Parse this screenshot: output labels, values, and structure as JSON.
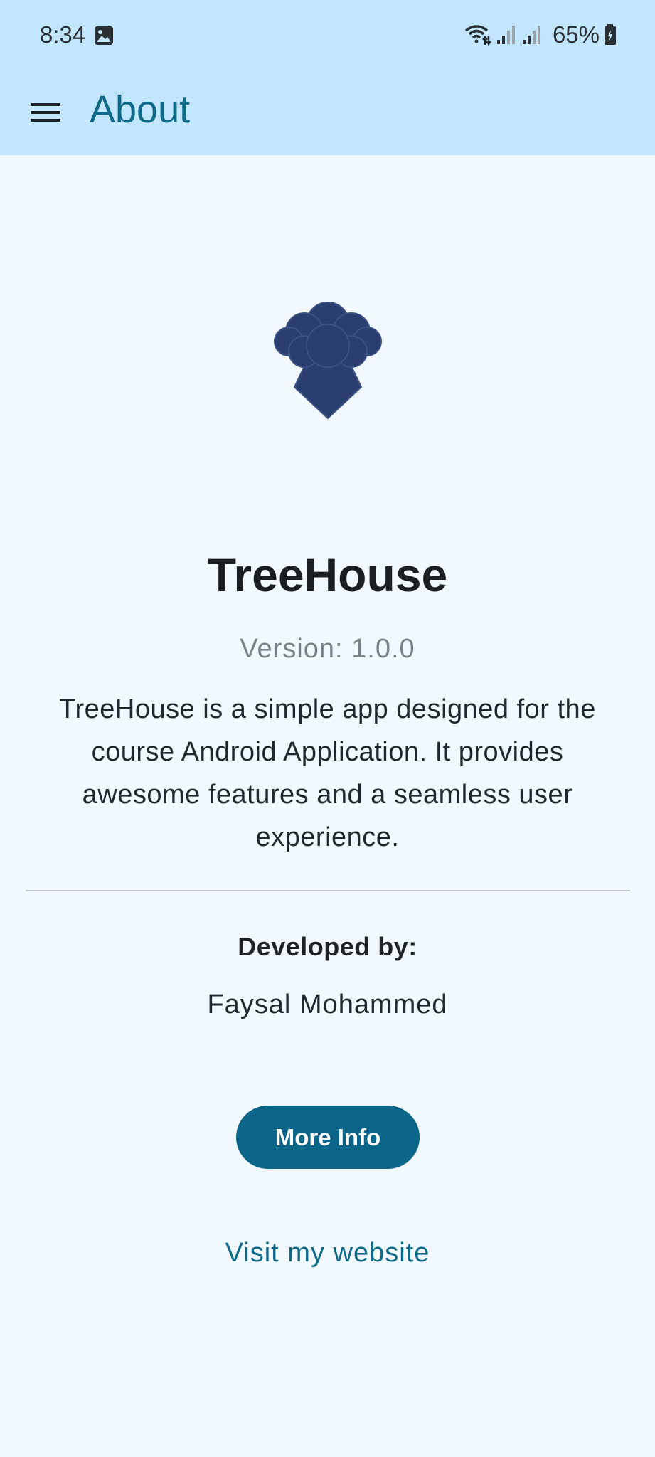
{
  "status_bar": {
    "time": "8:34",
    "battery": "65%",
    "icons": [
      "gallery-icon",
      "wifi-icon",
      "signal-icon",
      "signal-icon",
      "battery-icon"
    ]
  },
  "app_bar": {
    "title": "About",
    "menu_icon": "hamburger-menu-icon"
  },
  "logo": {
    "icon": "tree-logo-icon",
    "color": "#2a3f6e"
  },
  "app_name": "TreeHouse",
  "version": "Version: 1.0.0",
  "description": "TreeHouse is a simple app designed for the course Android Application. It provides awesome features and a seamless user experience.",
  "developer": {
    "label": "Developed by:",
    "name": "Faysal Mohammed"
  },
  "more_info_button": "More Info",
  "website_link": "Visit my website",
  "colors": {
    "app_bar_bg": "#c2e6fd",
    "page_bg": "#f1f8fe",
    "accent": "#0f6a89",
    "button_bg": "#0b6588"
  }
}
